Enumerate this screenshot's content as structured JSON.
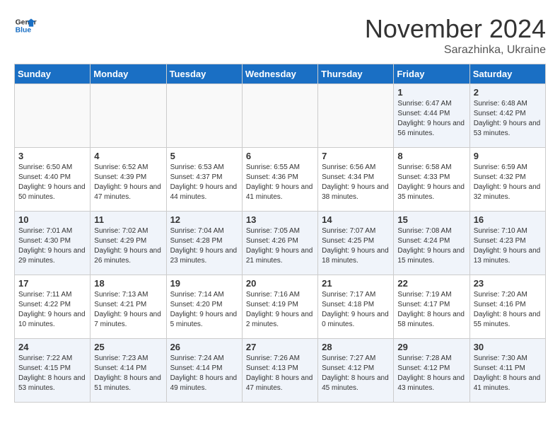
{
  "logo": {
    "line1": "General",
    "line2": "Blue"
  },
  "title": "November 2024",
  "subtitle": "Sarazhinka, Ukraine",
  "weekdays": [
    "Sunday",
    "Monday",
    "Tuesday",
    "Wednesday",
    "Thursday",
    "Friday",
    "Saturday"
  ],
  "weeks": [
    [
      {
        "day": "",
        "info": ""
      },
      {
        "day": "",
        "info": ""
      },
      {
        "day": "",
        "info": ""
      },
      {
        "day": "",
        "info": ""
      },
      {
        "day": "",
        "info": ""
      },
      {
        "day": "1",
        "info": "Sunrise: 6:47 AM\nSunset: 4:44 PM\nDaylight: 9 hours and 56 minutes."
      },
      {
        "day": "2",
        "info": "Sunrise: 6:48 AM\nSunset: 4:42 PM\nDaylight: 9 hours and 53 minutes."
      }
    ],
    [
      {
        "day": "3",
        "info": "Sunrise: 6:50 AM\nSunset: 4:40 PM\nDaylight: 9 hours and 50 minutes."
      },
      {
        "day": "4",
        "info": "Sunrise: 6:52 AM\nSunset: 4:39 PM\nDaylight: 9 hours and 47 minutes."
      },
      {
        "day": "5",
        "info": "Sunrise: 6:53 AM\nSunset: 4:37 PM\nDaylight: 9 hours and 44 minutes."
      },
      {
        "day": "6",
        "info": "Sunrise: 6:55 AM\nSunset: 4:36 PM\nDaylight: 9 hours and 41 minutes."
      },
      {
        "day": "7",
        "info": "Sunrise: 6:56 AM\nSunset: 4:34 PM\nDaylight: 9 hours and 38 minutes."
      },
      {
        "day": "8",
        "info": "Sunrise: 6:58 AM\nSunset: 4:33 PM\nDaylight: 9 hours and 35 minutes."
      },
      {
        "day": "9",
        "info": "Sunrise: 6:59 AM\nSunset: 4:32 PM\nDaylight: 9 hours and 32 minutes."
      }
    ],
    [
      {
        "day": "10",
        "info": "Sunrise: 7:01 AM\nSunset: 4:30 PM\nDaylight: 9 hours and 29 minutes."
      },
      {
        "day": "11",
        "info": "Sunrise: 7:02 AM\nSunset: 4:29 PM\nDaylight: 9 hours and 26 minutes."
      },
      {
        "day": "12",
        "info": "Sunrise: 7:04 AM\nSunset: 4:28 PM\nDaylight: 9 hours and 23 minutes."
      },
      {
        "day": "13",
        "info": "Sunrise: 7:05 AM\nSunset: 4:26 PM\nDaylight: 9 hours and 21 minutes."
      },
      {
        "day": "14",
        "info": "Sunrise: 7:07 AM\nSunset: 4:25 PM\nDaylight: 9 hours and 18 minutes."
      },
      {
        "day": "15",
        "info": "Sunrise: 7:08 AM\nSunset: 4:24 PM\nDaylight: 9 hours and 15 minutes."
      },
      {
        "day": "16",
        "info": "Sunrise: 7:10 AM\nSunset: 4:23 PM\nDaylight: 9 hours and 13 minutes."
      }
    ],
    [
      {
        "day": "17",
        "info": "Sunrise: 7:11 AM\nSunset: 4:22 PM\nDaylight: 9 hours and 10 minutes."
      },
      {
        "day": "18",
        "info": "Sunrise: 7:13 AM\nSunset: 4:21 PM\nDaylight: 9 hours and 7 minutes."
      },
      {
        "day": "19",
        "info": "Sunrise: 7:14 AM\nSunset: 4:20 PM\nDaylight: 9 hours and 5 minutes."
      },
      {
        "day": "20",
        "info": "Sunrise: 7:16 AM\nSunset: 4:19 PM\nDaylight: 9 hours and 2 minutes."
      },
      {
        "day": "21",
        "info": "Sunrise: 7:17 AM\nSunset: 4:18 PM\nDaylight: 9 hours and 0 minutes."
      },
      {
        "day": "22",
        "info": "Sunrise: 7:19 AM\nSunset: 4:17 PM\nDaylight: 8 hours and 58 minutes."
      },
      {
        "day": "23",
        "info": "Sunrise: 7:20 AM\nSunset: 4:16 PM\nDaylight: 8 hours and 55 minutes."
      }
    ],
    [
      {
        "day": "24",
        "info": "Sunrise: 7:22 AM\nSunset: 4:15 PM\nDaylight: 8 hours and 53 minutes."
      },
      {
        "day": "25",
        "info": "Sunrise: 7:23 AM\nSunset: 4:14 PM\nDaylight: 8 hours and 51 minutes."
      },
      {
        "day": "26",
        "info": "Sunrise: 7:24 AM\nSunset: 4:14 PM\nDaylight: 8 hours and 49 minutes."
      },
      {
        "day": "27",
        "info": "Sunrise: 7:26 AM\nSunset: 4:13 PM\nDaylight: 8 hours and 47 minutes."
      },
      {
        "day": "28",
        "info": "Sunrise: 7:27 AM\nSunset: 4:12 PM\nDaylight: 8 hours and 45 minutes."
      },
      {
        "day": "29",
        "info": "Sunrise: 7:28 AM\nSunset: 4:12 PM\nDaylight: 8 hours and 43 minutes."
      },
      {
        "day": "30",
        "info": "Sunrise: 7:30 AM\nSunset: 4:11 PM\nDaylight: 8 hours and 41 minutes."
      }
    ]
  ]
}
